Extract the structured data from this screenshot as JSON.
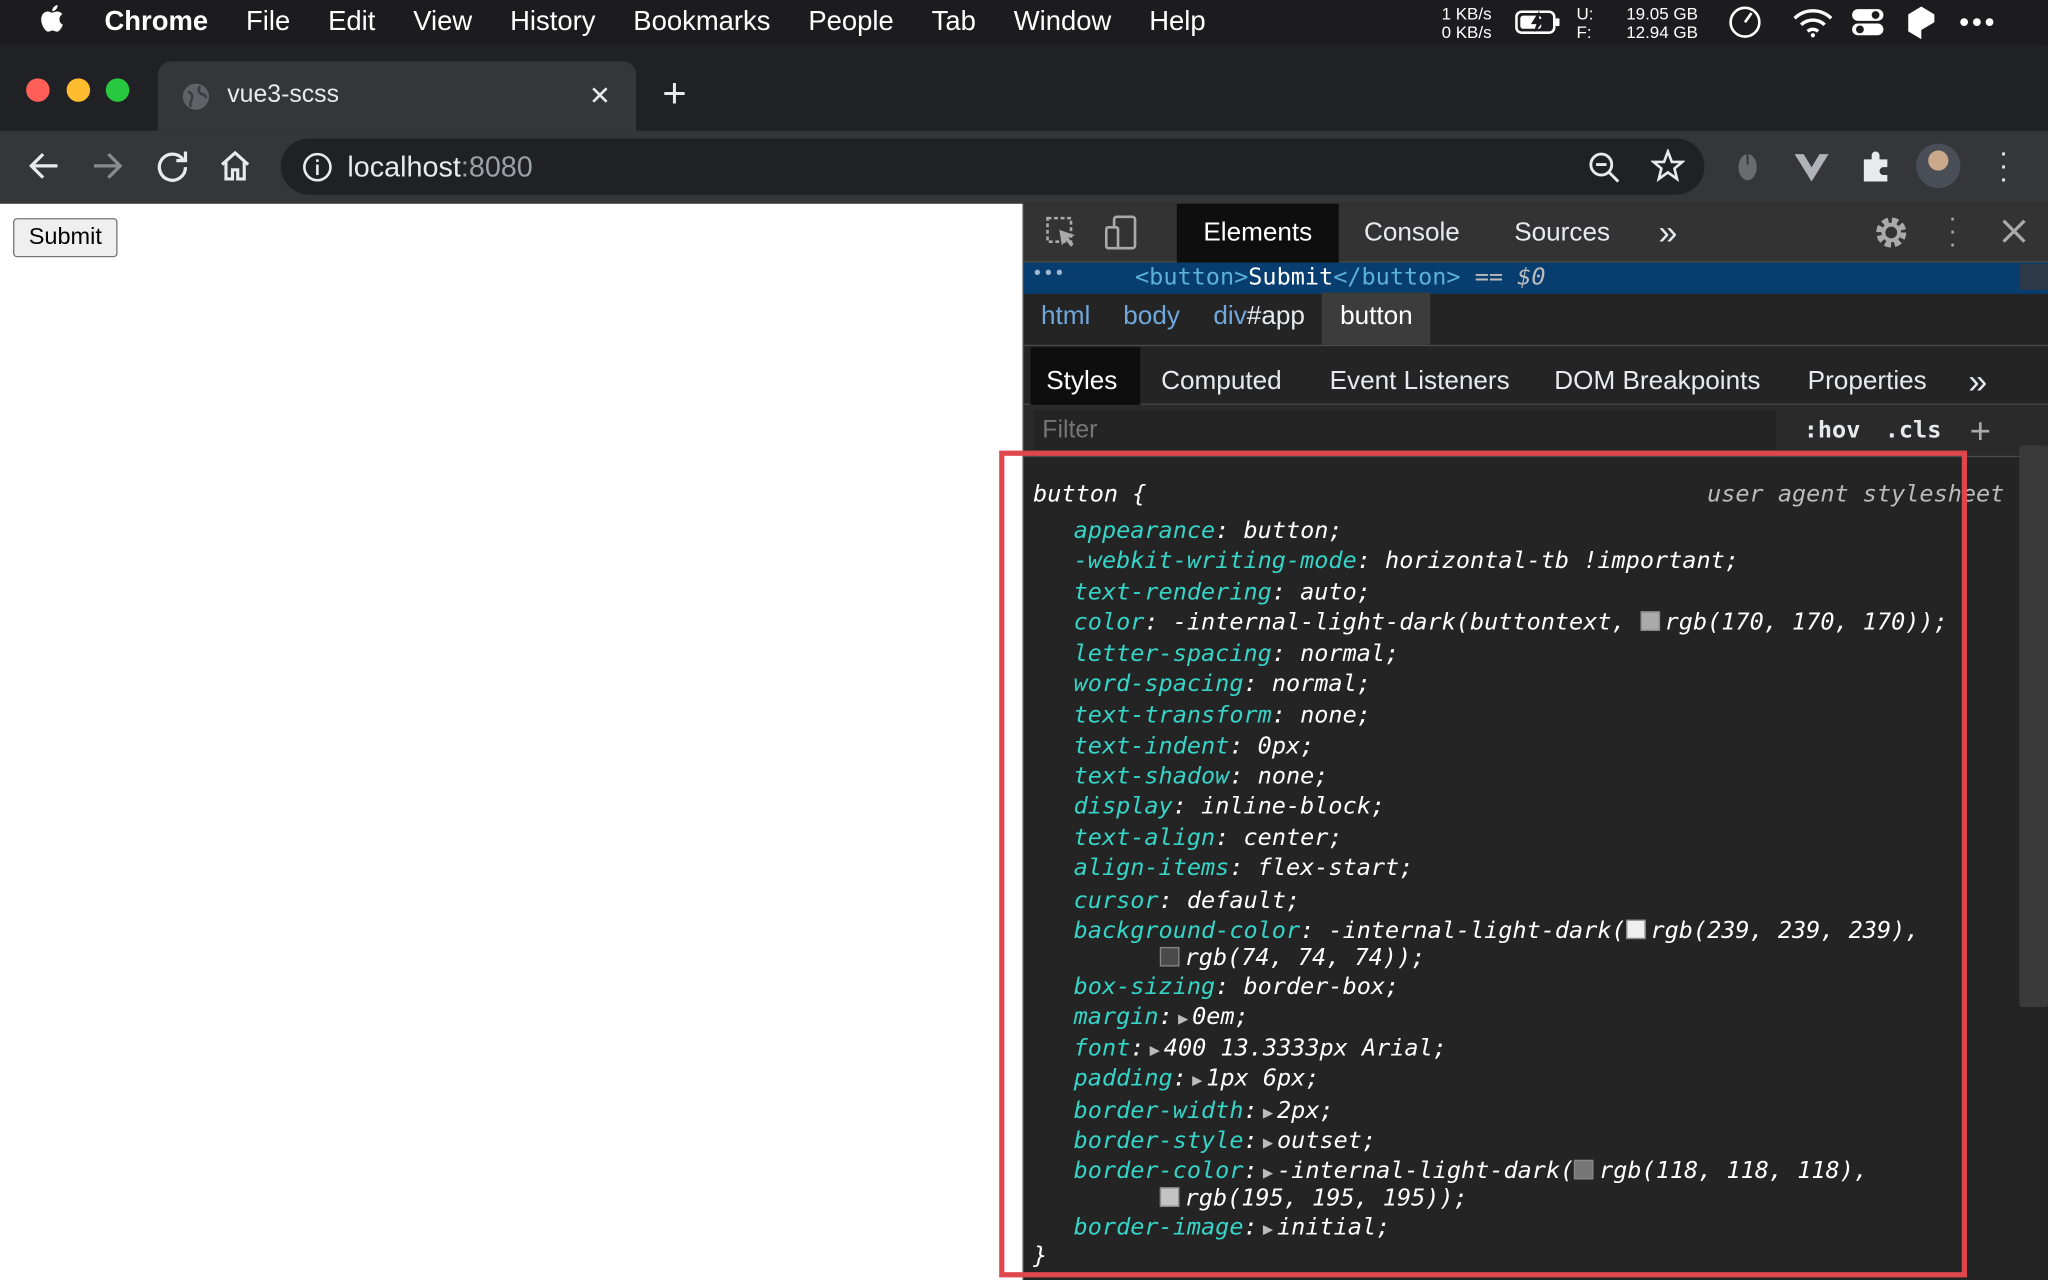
{
  "menubar": {
    "apple": "",
    "app": "Chrome",
    "items": [
      "File",
      "Edit",
      "View",
      "History",
      "Bookmarks",
      "People",
      "Tab",
      "Window",
      "Help"
    ],
    "net_up": "1 KB/s",
    "net_down": "0 KB/s",
    "disk_u_label": "U:",
    "disk_u": "19.05 GB",
    "disk_f_label": "F:",
    "disk_f": "12.94 GB"
  },
  "browser": {
    "tab_title": "vue3-scss",
    "tab_close": "✕",
    "new_tab": "+",
    "url_host": "localhost",
    "url_port": ":8080"
  },
  "page": {
    "submit_label": "Submit"
  },
  "devtools": {
    "tabs": [
      "Elements",
      "Console",
      "Sources"
    ],
    "more": "»",
    "selected_node": {
      "open": "<button>",
      "text": "Submit",
      "close": "</button>",
      "suffix": "== $0",
      "dots": "•••"
    },
    "breadcrumbs": {
      "html": "html",
      "body": "body",
      "div": "div",
      "div_id": "#app",
      "button": "button"
    },
    "panel_tabs": [
      "Styles",
      "Computed",
      "Event Listeners",
      "DOM Breakpoints",
      "Properties"
    ],
    "filter_placeholder": "Filter",
    "hov": ":hov",
    "cls": ".cls",
    "add": "+",
    "rule": {
      "selector": "button {",
      "origin": "user agent stylesheet",
      "close": "}"
    },
    "properties": [
      {
        "name": "appearance",
        "value": "button;"
      },
      {
        "name": "-webkit-writing-mode",
        "value": "horizontal-tb !important;"
      },
      {
        "name": "text-rendering",
        "value": "auto;"
      },
      {
        "name": "color",
        "value": "-internal-light-dark(buttontext, ",
        "swatch": "#aaaaaa",
        "value2": "rgb(170, 170, 170));"
      },
      {
        "name": "letter-spacing",
        "value": "normal;"
      },
      {
        "name": "word-spacing",
        "value": "normal;"
      },
      {
        "name": "text-transform",
        "value": "none;"
      },
      {
        "name": "text-indent",
        "value": "0px;"
      },
      {
        "name": "text-shadow",
        "value": "none;"
      },
      {
        "name": "display",
        "value": "inline-block;"
      },
      {
        "name": "text-align",
        "value": "center;"
      },
      {
        "name": "align-items",
        "value": "flex-start;"
      },
      {
        "name": "cursor",
        "value": "default;"
      },
      {
        "name": "background-color",
        "value": "-internal-light-dark(",
        "swatch": "#efefef",
        "value2": "rgb(239, 239, 239),"
      },
      {
        "name": "",
        "value": "",
        "swatch": "#4a4a4a",
        "value2": "rgb(74, 74, 74));"
      },
      {
        "name": "box-sizing",
        "value": "border-box;"
      },
      {
        "name": "margin",
        "value": "0em;",
        "expand": true
      },
      {
        "name": "font",
        "value": "400 13.3333px Arial;",
        "expand": true
      },
      {
        "name": "padding",
        "value": "1px 6px;",
        "expand": true
      },
      {
        "name": "border-width",
        "value": "2px;",
        "expand": true
      },
      {
        "name": "border-style",
        "value": "outset;",
        "expand": true
      },
      {
        "name": "border-color",
        "value": "-internal-light-dark(",
        "swatch": "#767676",
        "value2": "rgb(118, 118, 118),",
        "expand": true
      },
      {
        "name": "",
        "value": "",
        "swatch": "#c3c3c3",
        "value2": "rgb(195, 195, 195));"
      },
      {
        "name": "border-image",
        "value": "initial;",
        "expand": true
      }
    ]
  },
  "colors": {
    "highlight": "#e0474c",
    "property": "#35d4c7",
    "selection": "#073e6f"
  }
}
